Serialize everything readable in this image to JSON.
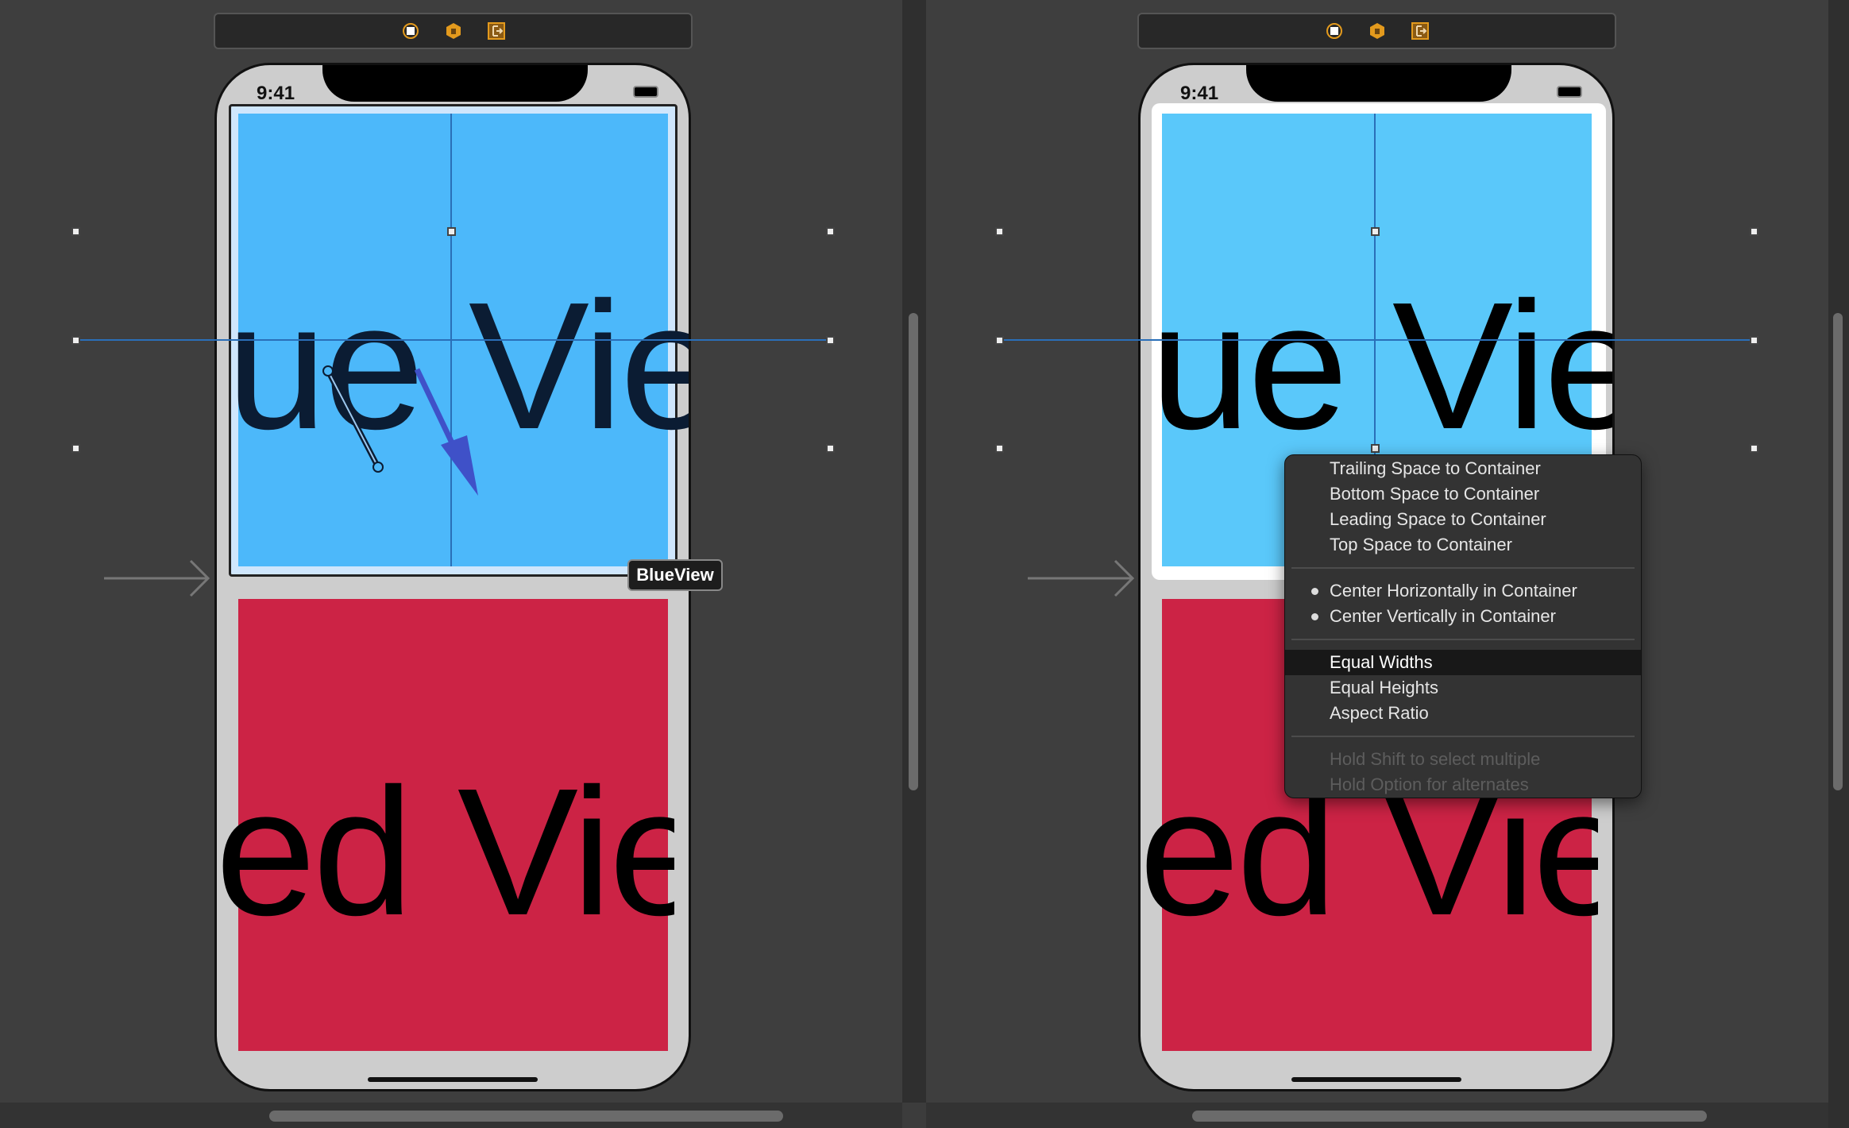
{
  "canvas": {
    "status_time": "9:41",
    "blue_view_text": "ue Vie",
    "red_view_text": "ed Vie",
    "selected_view_label": "BlueView"
  },
  "toolbar": {
    "icons": [
      "view-controller-icon",
      "first-responder-icon",
      "exit-icon"
    ]
  },
  "colors": {
    "blue_view": "#4cb8fa",
    "blue_view_right": "#5ac8fa",
    "red_view": "#cc2345",
    "guide": "#2a6fb8",
    "drag_arrow": "#3f51c8",
    "accent_icon": "#e39a1d"
  },
  "constraint_menu": {
    "group1": [
      {
        "label": "Trailing Space to Container"
      },
      {
        "label": "Bottom Space to Container"
      },
      {
        "label": "Leading Space to Container"
      },
      {
        "label": "Top Space to Container"
      }
    ],
    "group2": [
      {
        "label": "Center Horizontally in Container",
        "checked": true
      },
      {
        "label": "Center Vertically in Container",
        "checked": true
      }
    ],
    "group3": [
      {
        "label": "Equal Widths",
        "highlighted": true
      },
      {
        "label": "Equal Heights"
      },
      {
        "label": "Aspect Ratio"
      }
    ],
    "hints": [
      "Hold Shift to select multiple",
      "Hold Option for alternates"
    ]
  }
}
